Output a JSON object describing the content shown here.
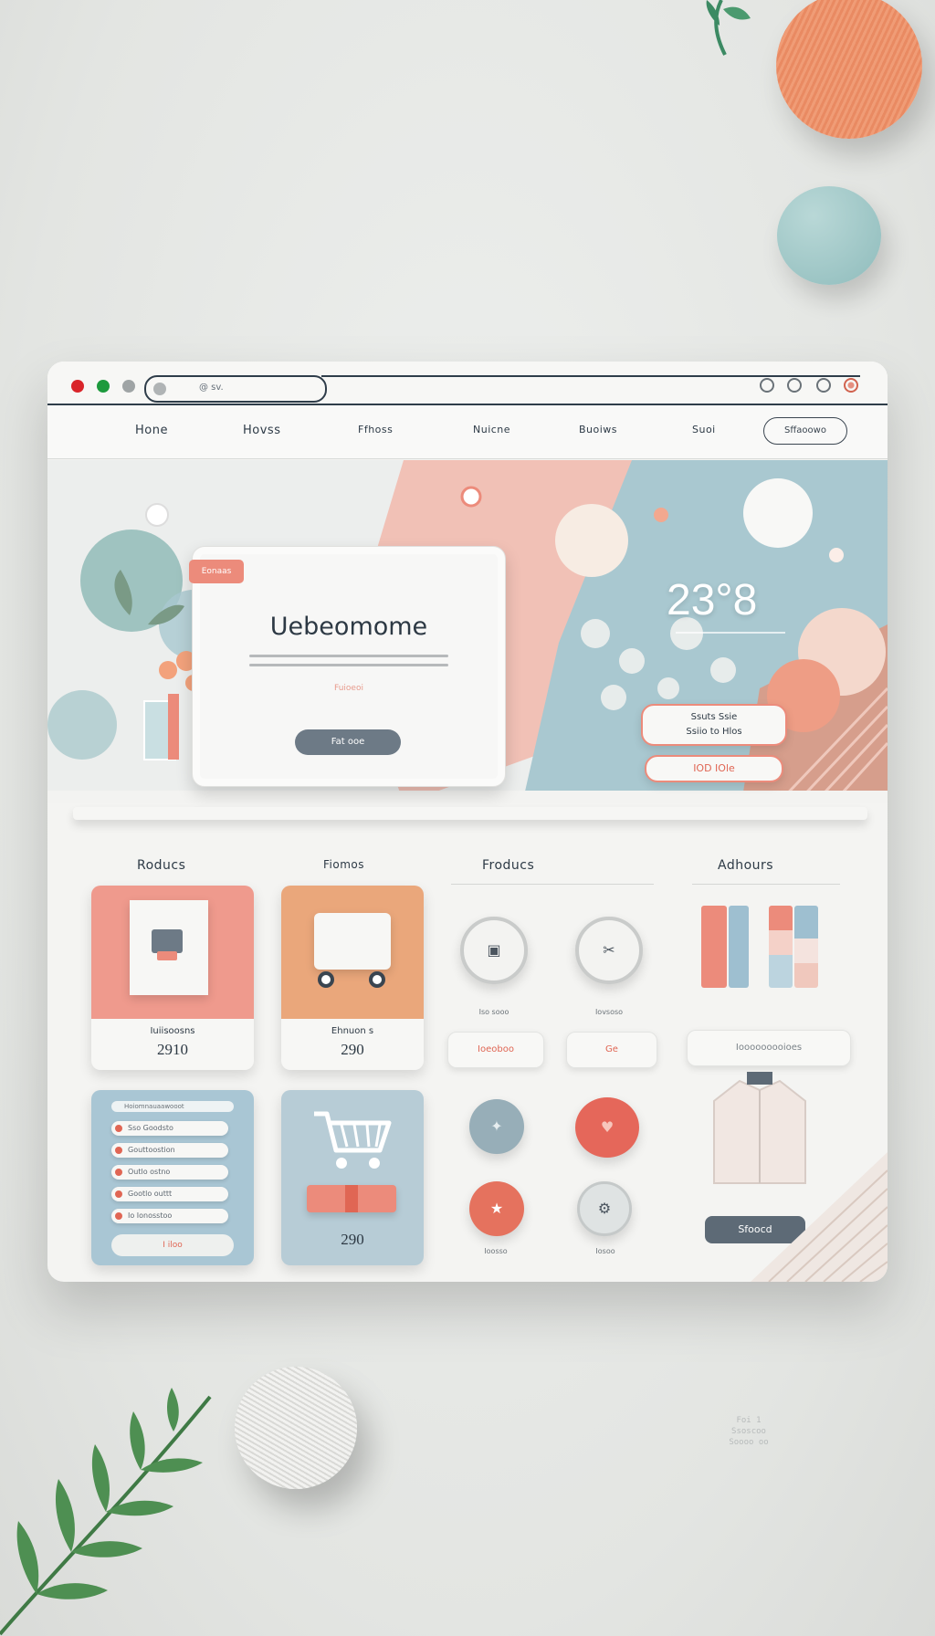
{
  "window": {
    "address_text": "@ sv.",
    "controls": [
      "close-dot",
      "maximize-dot",
      "minimize-dot"
    ]
  },
  "nav": {
    "items": [
      "Hone",
      "Hovss",
      "Ffhoss",
      "Nuicne",
      "Buoiws",
      "Suoi"
    ],
    "cta_label": "Sffaoowo"
  },
  "hero": {
    "tag_label": "Eonaas",
    "welcome_title": "Uebeomome",
    "welcome_sub": "Fuioeoi",
    "welcome_button": "Fat ooe",
    "temperature": "23°8",
    "pill_one_line1": "Ssuts   Ssie",
    "pill_one_line2": "Ssiio  to  Hlos",
    "pill_two": "IOD IOle"
  },
  "sections": [
    "Roducs",
    "Fiomos",
    "Froducs",
    "Adhours"
  ],
  "cards": [
    {
      "label": "Iuiisoosns",
      "price": "2910",
      "color": "#ef9a8d"
    },
    {
      "label": "Ehnuon s",
      "price": "290",
      "color": "#eaa77b"
    },
    {
      "label": "",
      "price": "290",
      "color": "#a9c6d4"
    }
  ],
  "list_card": {
    "header": "Hoiomnauaawooot",
    "rows": [
      "Sso  Goodsto",
      "Gouttoostion",
      "Outlo  ostno",
      "Gootlo  outtt",
      "Io  Ionosstoo"
    ],
    "footer": "I iloo"
  },
  "buttons": {
    "top_left_caption": "Iso sooo",
    "top_right_caption": "Iovsoso",
    "pill_a": "Ioeoboo",
    "pill_b": "Ge",
    "pill_c": "Iooooooooioes",
    "bottom_left_caption": "Ioosso",
    "bottom_right_caption": "Iosoo",
    "jacket_button": "Sfoocd"
  },
  "watermark_lines": [
    "Foi 1",
    "Ssoscoo",
    "Soooo oo"
  ],
  "colors": {
    "coral": "#ec8b7b",
    "teal": "#a9c6d4",
    "peach": "#eaa77b",
    "navy": "#2d3944",
    "panel": "#f4f4f2"
  }
}
